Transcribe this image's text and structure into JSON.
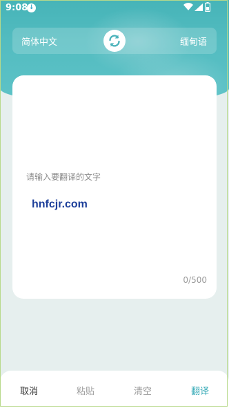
{
  "status_bar": {
    "time": "9:08",
    "notification_icon": "download-arrow-icon"
  },
  "languages": {
    "source": "简体中文",
    "target": "缅甸语",
    "swap_icon": "refresh-swap-icon"
  },
  "input": {
    "placeholder": "请输入要翻译的文字",
    "counter": "0/500"
  },
  "watermark": "hnfcjr.com",
  "actions": {
    "cancel": "取消",
    "paste": "粘贴",
    "clear": "清空",
    "translate": "翻译"
  },
  "colors": {
    "accent": "#34a9b6",
    "header": "#53bcc0",
    "background": "#e6efee"
  }
}
